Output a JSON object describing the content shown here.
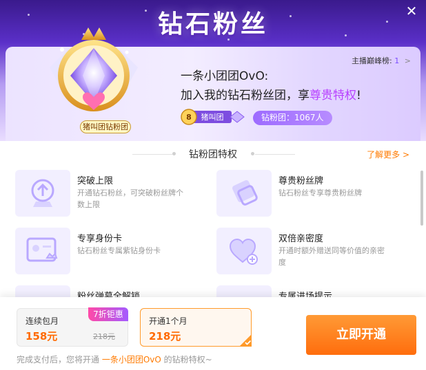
{
  "header": {
    "title": "钻石粉丝",
    "close_label": "✕",
    "rank": {
      "label": "主播巅峰榜:",
      "value": "1",
      "arrow": ">"
    },
    "badge_name": "猪叫团钻粉团",
    "streamer_line": "一条小团团OvO:",
    "invite_prefix": "加入我的钻石粉丝团，享",
    "invite_highlight": "尊贵特权",
    "invite_suffix": "!",
    "level_tag": {
      "level": "8",
      "name": "猪叫团"
    },
    "fans_count": "钻粉团：1067人"
  },
  "privileges": {
    "title": "钻粉团特权",
    "more": "了解更多 >",
    "items": [
      {
        "name": "突破上限",
        "desc_1": "开通钻石粉丝，可突破粉丝牌个",
        "desc_2": "数上限"
      },
      {
        "name": "尊贵粉丝牌",
        "desc_1": "钻石粉丝专享尊贵粉丝牌",
        "desc_2": ""
      },
      {
        "name": "专享身份卡",
        "desc_1": "钻石粉丝专属紫钻身份卡",
        "desc_2": ""
      },
      {
        "name": "双倍亲密度",
        "desc_1": "开通时额外赠送同等价值的亲密",
        "desc_2": "度"
      },
      {
        "name": "粉丝弹幕全解锁",
        "desc_1": "",
        "desc_2": ""
      },
      {
        "name": "专属进场提示",
        "desc_1": "",
        "desc_2": ""
      }
    ]
  },
  "plans": [
    {
      "name": "连续包月",
      "price": "158元",
      "original": "218元",
      "tag": "7折钜惠"
    },
    {
      "name": "开通1个月",
      "price": "218元"
    }
  ],
  "buy_button": "立即开通",
  "note": {
    "prefix": "完成支付后，您将开通 ",
    "highlight": "一条小团团OvO",
    "suffix": " 的钻粉特权~"
  },
  "colors": {
    "accent_orange": "#ff7a00",
    "accent_purple": "#9d6bff",
    "header_top": "#3a1a8c"
  }
}
